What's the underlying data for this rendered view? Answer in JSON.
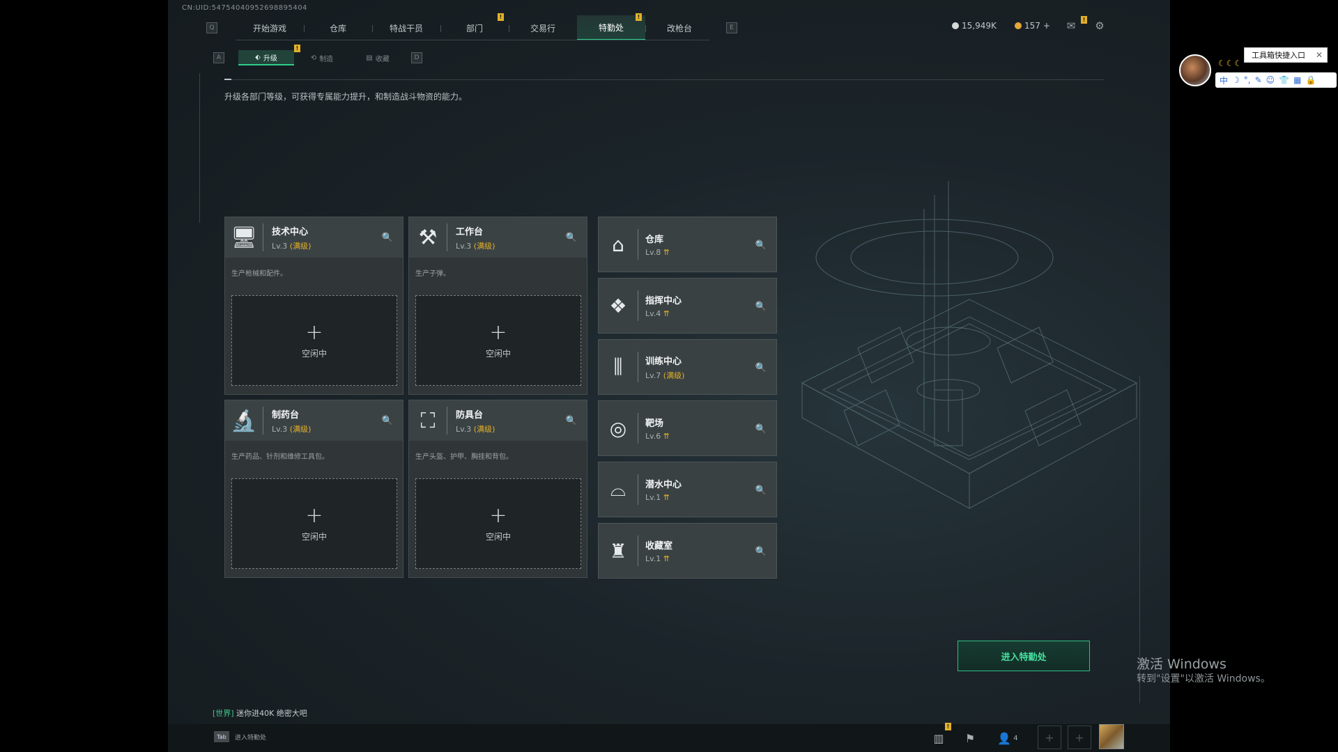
{
  "uid": "CN:UID:54754040952698895404",
  "nav": {
    "items": [
      "开始游戏",
      "仓库",
      "特战干员",
      "部门",
      "交易行",
      "特勤处",
      "改枪台"
    ],
    "left_key": "Q",
    "right_key": "E",
    "alert": "!"
  },
  "currency": {
    "money": "15,949K",
    "coins": "157",
    "add": "+"
  },
  "subnav": {
    "left_key": "A",
    "right_key": "D",
    "tabs": [
      "升级",
      "制造",
      "收藏"
    ]
  },
  "description": "升级各部门等级，可获得专属能力提升，和制造战斗物资的能力。",
  "big_cards": [
    {
      "name": "技术中心",
      "level": "Lv.3",
      "max": "(满级)",
      "desc": "生产枪械和配件。",
      "slot": "空闲中",
      "icon": "computer-icon"
    },
    {
      "name": "工作台",
      "level": "Lv.3",
      "max": "(满级)",
      "desc": "生产子弹。",
      "slot": "空闲中",
      "icon": "tools-icon"
    },
    {
      "name": "制药台",
      "level": "Lv.3",
      "max": "(满级)",
      "desc": "生产药品、针剂和维修工具包。",
      "slot": "空闲中",
      "icon": "microscope-icon"
    },
    {
      "name": "防具台",
      "level": "Lv.3",
      "max": "(满级)",
      "desc": "生产头盔、护甲、胸挂和背包。",
      "slot": "空闲中",
      "icon": "armor-icon"
    }
  ],
  "small_cards": [
    {
      "name": "仓库",
      "level": "Lv.8",
      "max": "",
      "icon": "warehouse-icon"
    },
    {
      "name": "指挥中心",
      "level": "Lv.4",
      "max": "",
      "icon": "command-icon"
    },
    {
      "name": "训练中心",
      "level": "Lv.7",
      "max": "(满级)",
      "icon": "dumbbell-icon"
    },
    {
      "name": "靶场",
      "level": "Lv.6",
      "max": "",
      "icon": "target-icon"
    },
    {
      "name": "潜水中心",
      "level": "Lv.1",
      "max": "",
      "icon": "diving-mask-icon"
    },
    {
      "name": "收藏室",
      "level": "Lv.1",
      "max": "",
      "icon": "trophy-icon"
    }
  ],
  "enter_button": "进入特勤处",
  "chat": {
    "channel": "[世界]",
    "message": "迷你进40K  绝密大吧"
  },
  "bottom": {
    "tab_key": "Tab",
    "tab_label": "进入特勤处",
    "friends": "4"
  },
  "watermark": {
    "line1": "激活 Windows",
    "line2": "转到\"设置\"以激活 Windows。"
  },
  "toolbox": {
    "tip": "工具箱快捷入口",
    "bar": [
      "中",
      "☽",
      "°,",
      "✎",
      "☺",
      "👕",
      "▦",
      "🔒"
    ]
  },
  "colors": {
    "accent": "#2ecf8d",
    "max": "#e3b12a",
    "alert": "#e3b12a"
  }
}
